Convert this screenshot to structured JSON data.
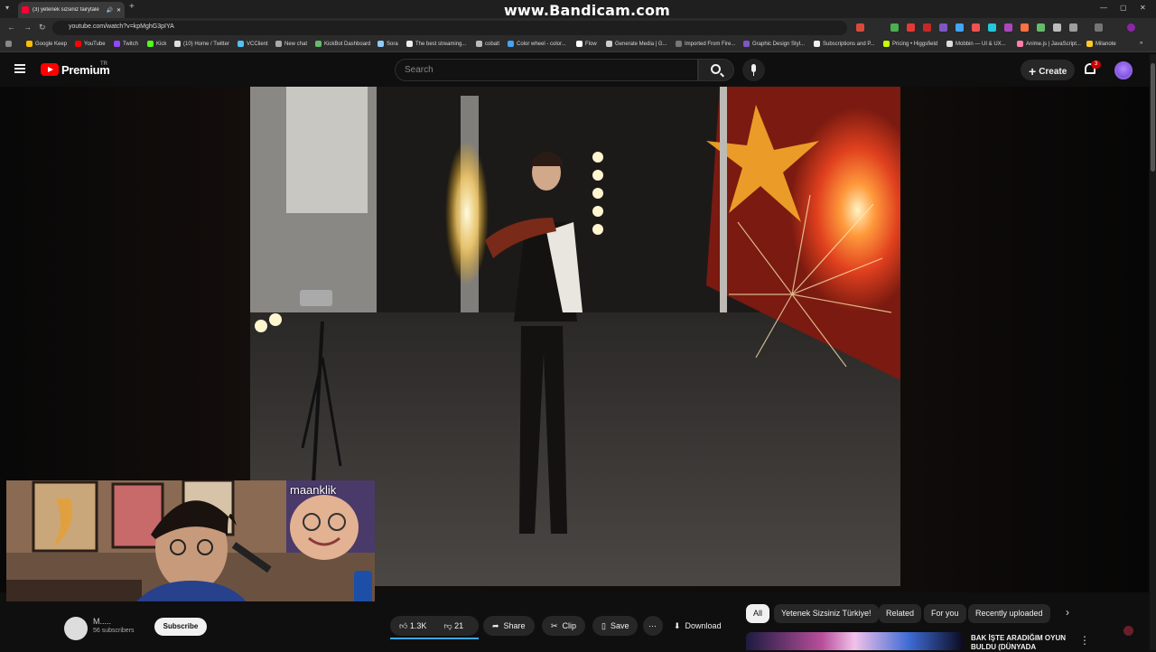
{
  "browser": {
    "tab_title": "(3) yetenek sizsiniz fairytale",
    "url": "youtube.com/watch?v=kpMghG3pIYA",
    "overlay_watermark": "www.Bandicam.com",
    "bookmarks": [
      "Google Keep",
      "YouTube",
      "Twitch",
      "Kick",
      "(10) Home / Twitter",
      "VCClient",
      "New chat",
      "KickBot Dashboard",
      "Sora",
      "The best streaming...",
      "cobalt",
      "Color wheel - color...",
      "Flow",
      "Generate Media | G...",
      "Imported From Fire...",
      "Graphic Design Styl...",
      "Subscriptions and P...",
      "Pricing • Higgsfield",
      "Mobbin — UI & UX...",
      "Anime.js | JavaScript...",
      "Milanote"
    ]
  },
  "youtube": {
    "logo_text": "Premium",
    "logo_region": "TR",
    "search_placeholder": "Search",
    "create_label": "Create",
    "notification_count": "3"
  },
  "webcam": {
    "overlay_label": "maanklik"
  },
  "channel": {
    "name": "M.....",
    "subscribers": "56 subscribers",
    "subscribe_label": "Subscribe"
  },
  "actions": {
    "like_count": "1.3K",
    "dislike_count": "21",
    "share_label": "Share",
    "clip_label": "Clip",
    "save_label": "Save",
    "download_label": "Download"
  },
  "chips": [
    "All",
    "Yetenek Sizsiniz Türkiye!",
    "Related",
    "For you",
    "Recently uploaded"
  ],
  "recommendation": {
    "title": "BAK İŞTE ARADIĞIM OYUN BULDU (DÜNYADA"
  },
  "colors": {
    "accent_red": "#ff0000",
    "like_bar": "#3ea6ff"
  }
}
